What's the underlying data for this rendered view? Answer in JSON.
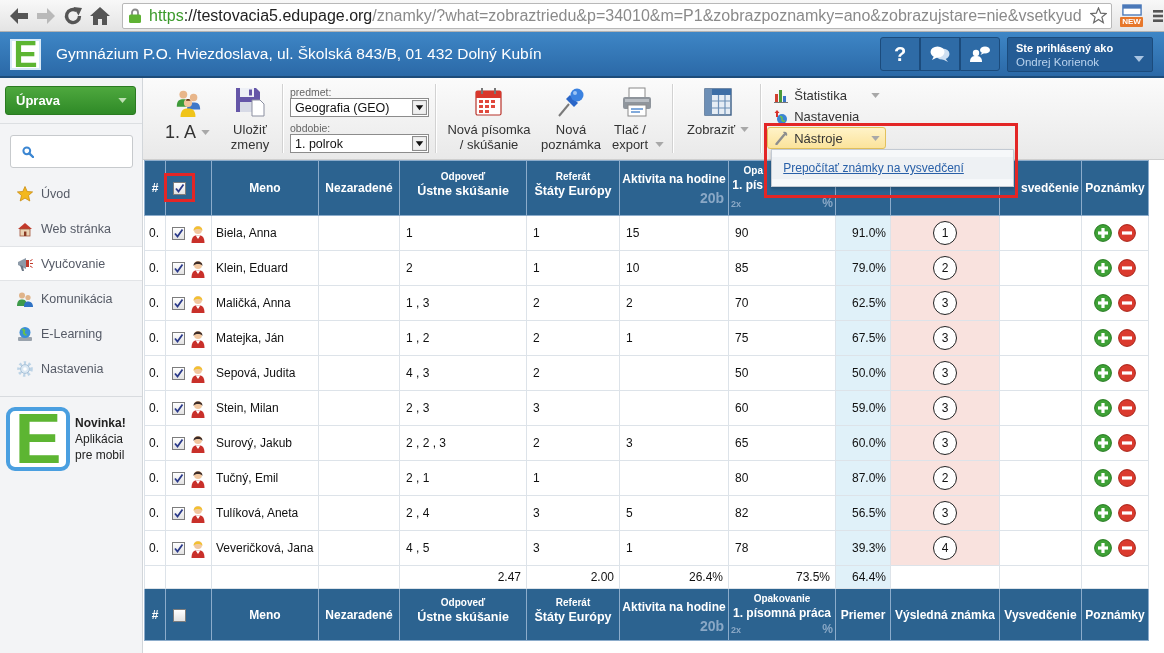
{
  "browser": {
    "nav": [
      {
        "kind": "back",
        "disabled": false
      },
      {
        "kind": "forward",
        "disabled": true
      },
      {
        "kind": "reload",
        "disabled": false
      },
      {
        "kind": "home",
        "disabled": false
      }
    ],
    "url_parts": [
      {
        "kind": "scheme",
        "text": "https"
      },
      {
        "kind": "host",
        "text": "://testovacia5.edupage.org"
      },
      {
        "kind": "path",
        "text": "/znamky/?what=zobraztriedu&p=34010&m=P1&zobrazpoznamky=ano&zobrazujstare=nie&vsetkyud"
      }
    ],
    "extension_badge": "NEW"
  },
  "header": {
    "logo": "E",
    "title": "Gymnázium P.O. Hviezdoslava, ul. Školská 843/B, 01 432 Dolný Kubín",
    "buttons": [
      {
        "kind": "help",
        "label": "?"
      },
      {
        "kind": "chat"
      },
      {
        "kind": "contact"
      }
    ],
    "user": {
      "caption": "Ste prihlásený ako",
      "name": "Ondrej Korienok"
    }
  },
  "sidebar": {
    "action_button": "Úprava",
    "items": [
      {
        "kind": "home",
        "label": "Úvod",
        "selected": false
      },
      {
        "kind": "web",
        "label": "Web stránka",
        "selected": false
      },
      {
        "kind": "teaching",
        "label": "Vyučovanie",
        "selected": true
      },
      {
        "kind": "communication",
        "label": "Komunikácia",
        "selected": false
      },
      {
        "kind": "elearning",
        "label": "E-Learning",
        "selected": false
      },
      {
        "kind": "settings",
        "label": "Nastavenia",
        "selected": false
      }
    ],
    "promo": {
      "logo": "E",
      "text": "**Novinka!** Aplikácia pre mobil"
    }
  },
  "toolbar": {
    "class_picker": {
      "label": "1. A",
      "dropdown": true
    },
    "save_button": "Uložiť zmeny",
    "filters": [
      {
        "label": "predmet:",
        "value": "Geografia (GEO)"
      },
      {
        "label": "obdobie:",
        "value": "1. polrok"
      }
    ],
    "actions": [
      {
        "kind": "test",
        "label": "Nová písomka / skúšanie",
        "dropdown": false
      },
      {
        "kind": "note",
        "label": "Nová poznámka",
        "dropdown": false
      },
      {
        "kind": "print",
        "label": "Tlač / export",
        "dropdown": true
      }
    ],
    "view_button": {
      "label": "Zobraziť",
      "dropdown": true
    },
    "menus": [
      {
        "kind": "stats",
        "label": "Štatistika",
        "dropdown": true,
        "expanded": false,
        "highlighted": false
      },
      {
        "kind": "settings",
        "label": "Nastavenia",
        "dropdown": false,
        "expanded": false,
        "highlighted": false
      },
      {
        "kind": "tools",
        "label": "Nástroje",
        "dropdown": true,
        "expanded": true,
        "highlighted": true,
        "items": [
          "Prepočítať známky na vysvedčení"
        ]
      }
    ]
  },
  "table": {
    "header_top": [
      {
        "kind": "text",
        "label": "#"
      },
      {
        "kind": "checkbox",
        "checked": true,
        "highlighted": true
      },
      {
        "kind": "text",
        "label": "Meno"
      },
      {
        "kind": "text",
        "label": "Nezaradené"
      },
      {
        "kind": "titled",
        "caption": "Odpoveď",
        "label": "Ústne skúšanie"
      },
      {
        "kind": "titled",
        "caption": "Referát",
        "label": "Štáty Európy"
      },
      {
        "kind": "scored",
        "label": "Aktivita na hodine",
        "points": "20b"
      },
      {
        "kind": "weighted",
        "caption": "Opa",
        "label": "1. pís",
        "weight": "2x",
        "unit": "%"
      },
      {
        "kind": "covered"
      },
      {
        "kind": "covered"
      },
      {
        "kind": "text",
        "label": "svedčenie"
      },
      {
        "kind": "text",
        "label": "Poznámky"
      }
    ],
    "rows": [
      {
        "number": "0.",
        "checked": true,
        "avatar": {
          "color": "#f2c12e"
        },
        "name": "Biela, Anna",
        "response": "1",
        "report": "1",
        "activity": "15",
        "test": "90",
        "average": "91.0%",
        "grade": "1"
      },
      {
        "number": "0.",
        "checked": true,
        "avatar": {
          "color": "#3a2a26"
        },
        "name": "Klein, Eduard",
        "response": "2",
        "report": "1",
        "activity": "10",
        "test": "85",
        "average": "79.0%",
        "grade": "2"
      },
      {
        "number": "0.",
        "checked": true,
        "avatar": {
          "color": "#f2c12e"
        },
        "name": "Maličká, Anna",
        "response": "1 , 3",
        "report": "2",
        "activity": "2",
        "test": "70",
        "average": "62.5%",
        "grade": "3"
      },
      {
        "number": "0.",
        "checked": true,
        "avatar": {
          "color": "#3a2a26"
        },
        "name": "Matejka, Ján",
        "response": "1 , 2",
        "report": "2",
        "activity": "1",
        "test": "75",
        "average": "67.5%",
        "grade": "3"
      },
      {
        "number": "0.",
        "checked": true,
        "avatar": {
          "color": "#f2c12e"
        },
        "name": "Sepová, Judita",
        "response": "4 , 3",
        "report": "2",
        "test": "50",
        "average": "50.0%",
        "grade": "3"
      },
      {
        "number": "0.",
        "checked": true,
        "avatar": {
          "color": "#3a2a26"
        },
        "name": "Stein, Milan",
        "response": "2 , 3",
        "report": "3",
        "test": "60",
        "average": "59.0%",
        "grade": "3"
      },
      {
        "number": "0.",
        "checked": true,
        "avatar": {
          "color": "#3a2a26"
        },
        "name": "Surový, Jakub",
        "response": "2 , 2 , 3",
        "report": "2",
        "activity": "3",
        "test": "65",
        "average": "60.0%",
        "grade": "3"
      },
      {
        "number": "0.",
        "checked": true,
        "avatar": {
          "color": "#3a2a26"
        },
        "name": "Tučný, Emil",
        "response": "2 , 1",
        "report": "1",
        "test": "80",
        "average": "87.0%",
        "grade": "2"
      },
      {
        "number": "0.",
        "checked": true,
        "avatar": {
          "color": "#f2c12e"
        },
        "name": "Tulíková, Aneta",
        "response": "2 , 4",
        "report": "3",
        "activity": "5",
        "test": "82",
        "average": "56.5%",
        "grade": "3"
      },
      {
        "number": "0.",
        "checked": true,
        "avatar": {
          "color": "#f2c12e"
        },
        "name": "Veveričková, Jana",
        "response": "4 , 5",
        "report": "3",
        "activity": "1",
        "test": "78",
        "average": "39.3%",
        "grade": "4"
      }
    ],
    "totals": {
      "response": "2.47",
      "report": "2.00",
      "activity": "26.4%",
      "test": "73.5%",
      "average": "64.4%"
    },
    "header_bottom": [
      {
        "kind": "text",
        "label": "#"
      },
      {
        "kind": "checkbox",
        "checked": false,
        "highlighted": false
      },
      {
        "kind": "text",
        "label": "Meno"
      },
      {
        "kind": "text",
        "label": "Nezaradené"
      },
      {
        "kind": "titled",
        "caption": "Odpoveď",
        "label": "Ústne skúšanie"
      },
      {
        "kind": "titled",
        "caption": "Referát",
        "label": "Štáty Európy"
      },
      {
        "kind": "scored",
        "label": "Aktivita na hodine",
        "points": "20b"
      },
      {
        "kind": "weighted",
        "caption": "Opakovanie",
        "label": "1. písomná práca",
        "weight": "2x",
        "unit": "%"
      },
      {
        "kind": "text",
        "label": "Priemer"
      },
      {
        "kind": "text",
        "label": "Výsledná známka"
      },
      {
        "kind": "text",
        "label": "Vysvedčenie"
      },
      {
        "kind": "text",
        "label": "Poznámky"
      }
    ]
  }
}
